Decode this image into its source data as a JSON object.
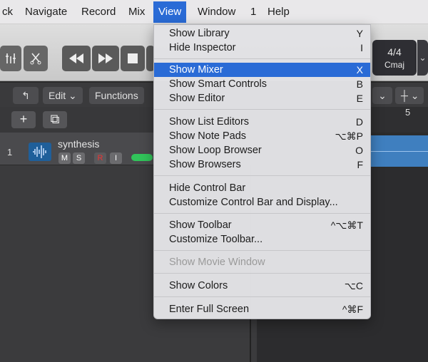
{
  "menubar": {
    "items": [
      "ck",
      "Navigate",
      "Record",
      "Mix",
      "View",
      "Window",
      "1",
      "Help"
    ],
    "active": "View"
  },
  "controlbar": {
    "time_signature": "4/4",
    "key": "Cmaj"
  },
  "tracks_toolbar": {
    "edit_label": "Edit",
    "functions_label": "Functions"
  },
  "ruler": {
    "bar_number": "5"
  },
  "track": {
    "number": "1",
    "name": "synthesis",
    "buttons": [
      "M",
      "S",
      "R",
      "I"
    ]
  },
  "view_menu": {
    "groups": [
      [
        {
          "label": "Show Library",
          "shortcut": "Y"
        },
        {
          "label": "Hide Inspector",
          "shortcut": "I"
        }
      ],
      [
        {
          "label": "Show Mixer",
          "shortcut": "X",
          "highlighted": true
        },
        {
          "label": "Show Smart Controls",
          "shortcut": "B"
        },
        {
          "label": "Show Editor",
          "shortcut": "E"
        }
      ],
      [
        {
          "label": "Show List Editors",
          "shortcut": "D"
        },
        {
          "label": "Show Note Pads",
          "shortcut": "⌥⌘P"
        },
        {
          "label": "Show Loop Browser",
          "shortcut": "O"
        },
        {
          "label": "Show Browsers",
          "shortcut": "F"
        }
      ],
      [
        {
          "label": "Hide Control Bar",
          "shortcut": ""
        },
        {
          "label": "Customize Control Bar and Display...",
          "shortcut": ""
        }
      ],
      [
        {
          "label": "Show Toolbar",
          "shortcut": "^⌥⌘T"
        },
        {
          "label": "Customize Toolbar...",
          "shortcut": ""
        }
      ],
      [
        {
          "label": "Show Movie Window",
          "shortcut": "",
          "disabled": true
        }
      ],
      [
        {
          "label": "Show Colors",
          "shortcut": "⌥C"
        }
      ],
      [
        {
          "label": "Enter Full Screen",
          "shortcut": "^⌘F"
        }
      ]
    ]
  }
}
